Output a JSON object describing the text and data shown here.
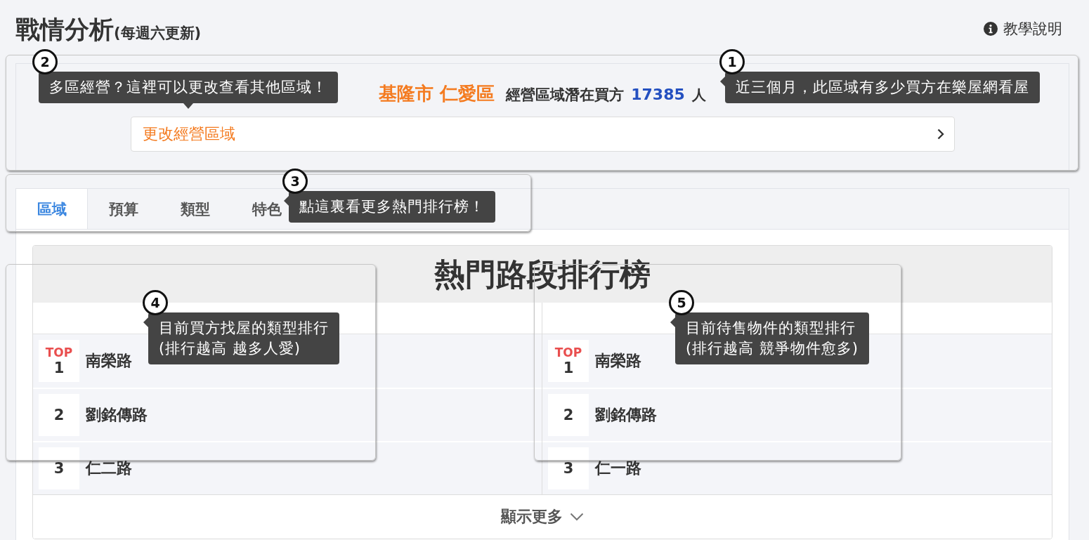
{
  "header": {
    "title": "戰情分析",
    "subtitle": "(每週六更新)",
    "help_link": "教學說明"
  },
  "region": {
    "area": "基隆市 仁愛區",
    "label": "經營區域潛在買方",
    "count": "17385",
    "unit": "人",
    "change_button": "更改經營區域"
  },
  "tabs": [
    {
      "label": "區域",
      "selected": true
    },
    {
      "label": "預算",
      "selected": false
    },
    {
      "label": "類型",
      "selected": false
    },
    {
      "label": "特色",
      "selected": false
    }
  ],
  "ranking": {
    "title": "熱門路段排行榜",
    "columns": [
      {
        "rows": [
          {
            "badge": "TOP",
            "rank": "1",
            "name": "南榮路"
          },
          {
            "rank": "2",
            "name": "劉銘傳路"
          },
          {
            "rank": "3",
            "name": "仁二路"
          }
        ]
      },
      {
        "rows": [
          {
            "badge": "TOP",
            "rank": "1",
            "name": "南榮路"
          },
          {
            "rank": "2",
            "name": "劉銘傳路"
          },
          {
            "rank": "3",
            "name": "仁一路"
          }
        ]
      }
    ],
    "show_more": "顯示更多"
  },
  "guide": [
    {
      "number": "2",
      "text": "多區經營？這裡可以更改查看其他區域！"
    },
    {
      "number": "1",
      "text": "近三個月，此區域有多少買方在樂屋網看屋"
    },
    {
      "number": "3",
      "text": "點這裏看更多熱門排行榜！"
    },
    {
      "number": "4",
      "text": "目前買方找屋的類型排行\n(排行越高 越多人愛)"
    },
    {
      "number": "5",
      "text": "目前待售物件的類型排行\n(排行越高 競爭物件愈多)"
    }
  ]
}
